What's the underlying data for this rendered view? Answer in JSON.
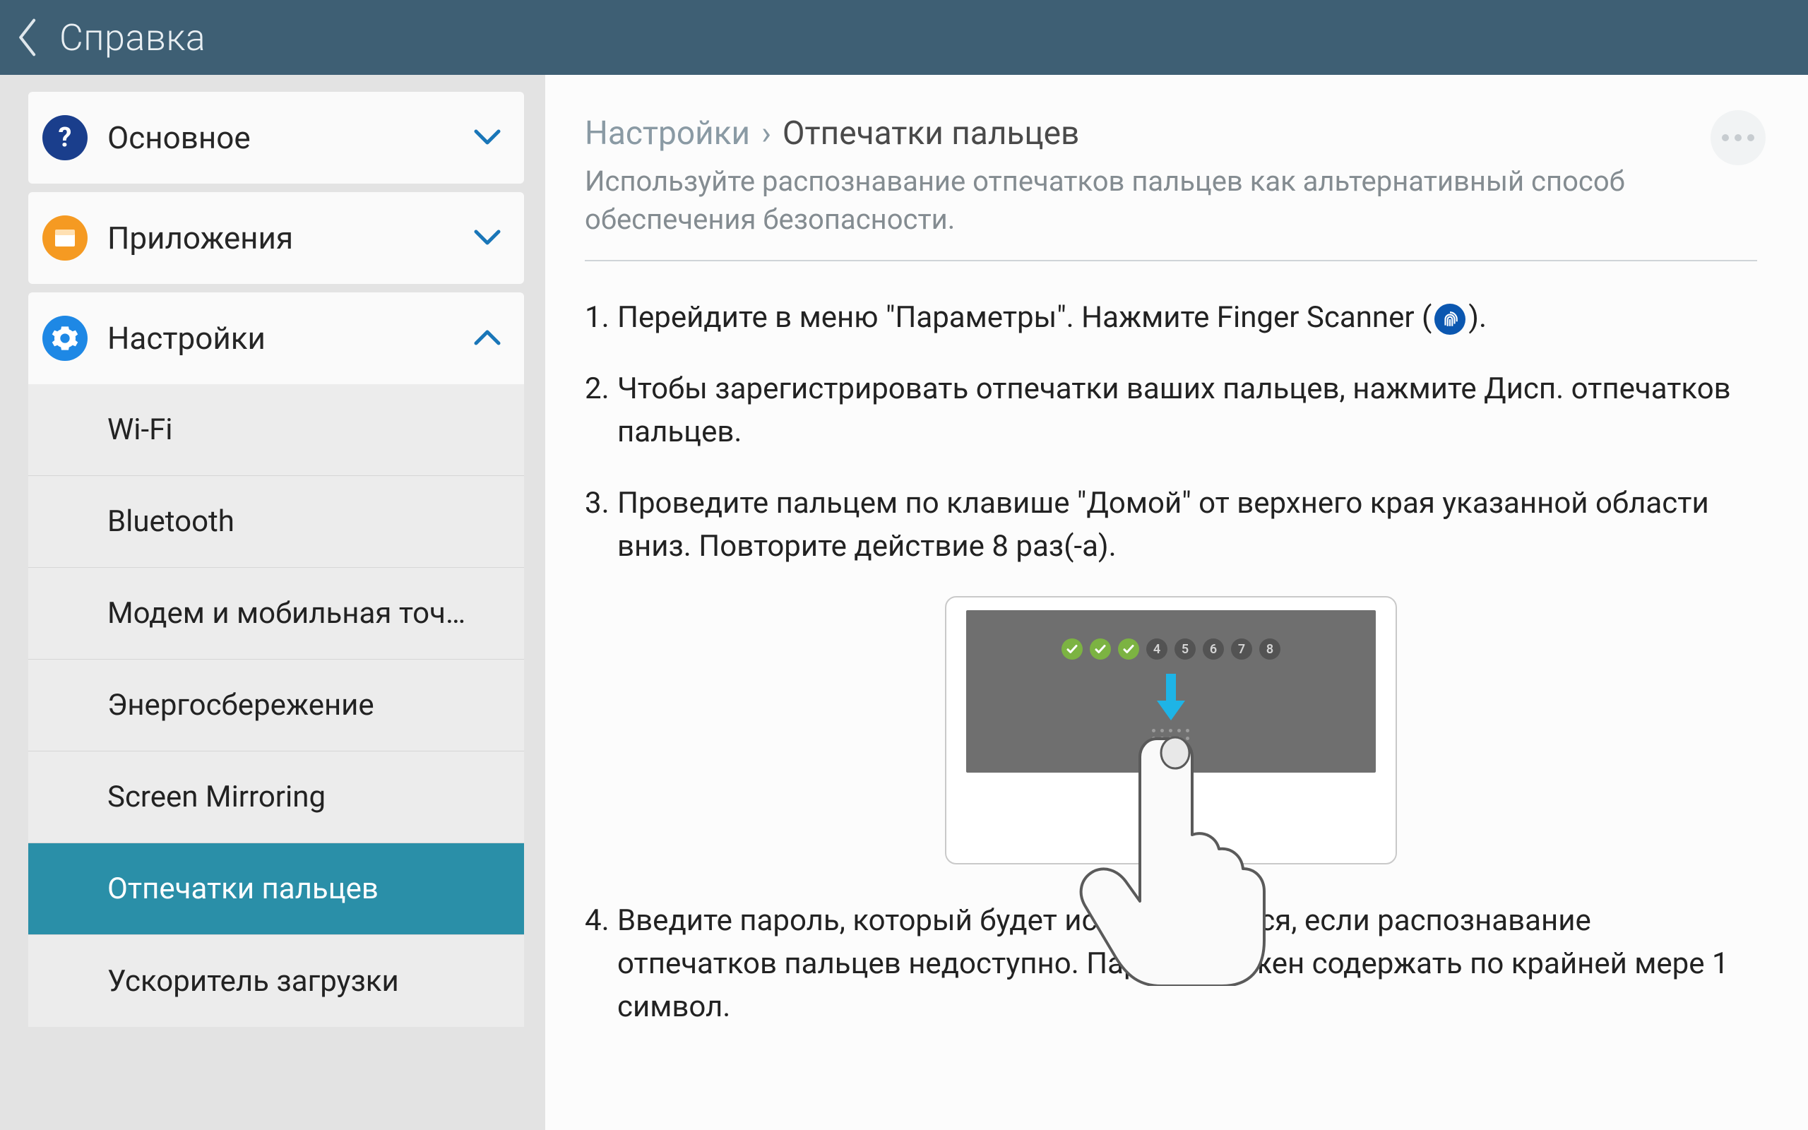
{
  "header": {
    "title": "Справка"
  },
  "sidebar": {
    "sections": [
      {
        "label": "Основное",
        "icon": "question",
        "expanded": false
      },
      {
        "label": "Приложения",
        "icon": "apps",
        "expanded": false
      },
      {
        "label": "Настройки",
        "icon": "gear",
        "expanded": true
      }
    ],
    "settings_items": [
      "Wi-Fi",
      "Bluetooth",
      "Модем и мобильная точ…",
      "Энергосбережение",
      "Screen Mirroring",
      "Отпечатки пальцев",
      "Ускоритель загрузки"
    ],
    "selected_index": 5
  },
  "content": {
    "breadcrumb": {
      "parent": "Настройки",
      "current": "Отпечатки пальцев"
    },
    "subtitle": "Используйте распознавание отпечатков пальцев как альтернативный способ обеспечения безопасности.",
    "steps": {
      "s1a": "Перейдите в меню \"Параметры\". Нажмите Finger Scanner (",
      "s1b": ").",
      "s2": "Чтобы зарегистрировать отпечатки ваших пальцев, нажмите Дисп. отпечатков пальцев.",
      "s3": "Проведите пальцем по клавише \"Домой\" от верхнего края указанной области вниз. Повторите действие 8 раз(-а).",
      "s4": "Введите пароль, который будет использоваться, если распознавание отпечатков пальцев недоступно. Пароль должен содержать по крайней мере 1 символ."
    },
    "illustration": {
      "badges": [
        {
          "done": true,
          "label": ""
        },
        {
          "done": true,
          "label": ""
        },
        {
          "done": true,
          "label": ""
        },
        {
          "done": false,
          "label": "4"
        },
        {
          "done": false,
          "label": "5"
        },
        {
          "done": false,
          "label": "6"
        },
        {
          "done": false,
          "label": "7"
        },
        {
          "done": false,
          "label": "8"
        }
      ]
    }
  }
}
